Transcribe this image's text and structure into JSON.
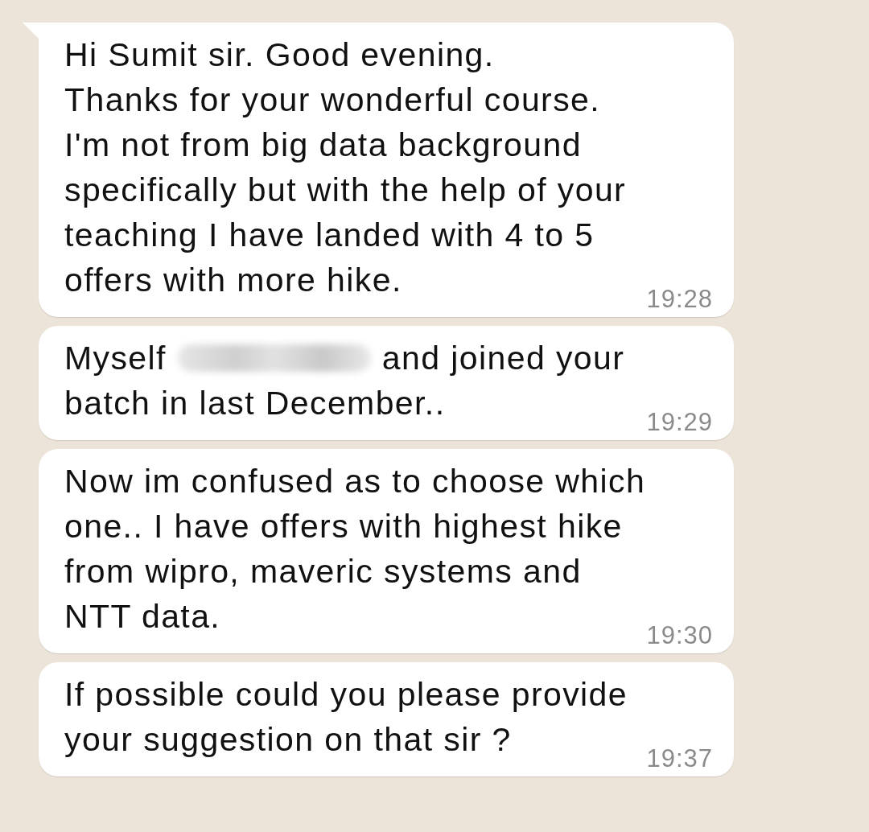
{
  "messages": [
    {
      "tail": true,
      "segments": [
        {
          "kind": "text",
          "text": "Hi Sumit sir. Good evening.\nThanks for your wonderful course.\nI'm not from big data background\nspecifically but with the help of your\nteaching I have landed with 4 to 5\noffers with more hike."
        }
      ],
      "time": "19:28"
    },
    {
      "tail": false,
      "segments": [
        {
          "kind": "text",
          "text": "Myself"
        },
        {
          "kind": "redacted"
        },
        {
          "kind": "text",
          "text": "and joined your"
        },
        {
          "kind": "break"
        },
        {
          "kind": "text",
          "text": "batch in last December.."
        }
      ],
      "time": "19:29"
    },
    {
      "tail": false,
      "segments": [
        {
          "kind": "text",
          "text": "Now im confused as to choose which\none.. I have offers with highest hike\nfrom wipro, maveric systems and\nNTT data."
        }
      ],
      "time": "19:30"
    },
    {
      "tail": false,
      "segments": [
        {
          "kind": "text",
          "text": "If possible could you please provide\nyour suggestion on that sir ?"
        }
      ],
      "time": "19:37"
    }
  ]
}
